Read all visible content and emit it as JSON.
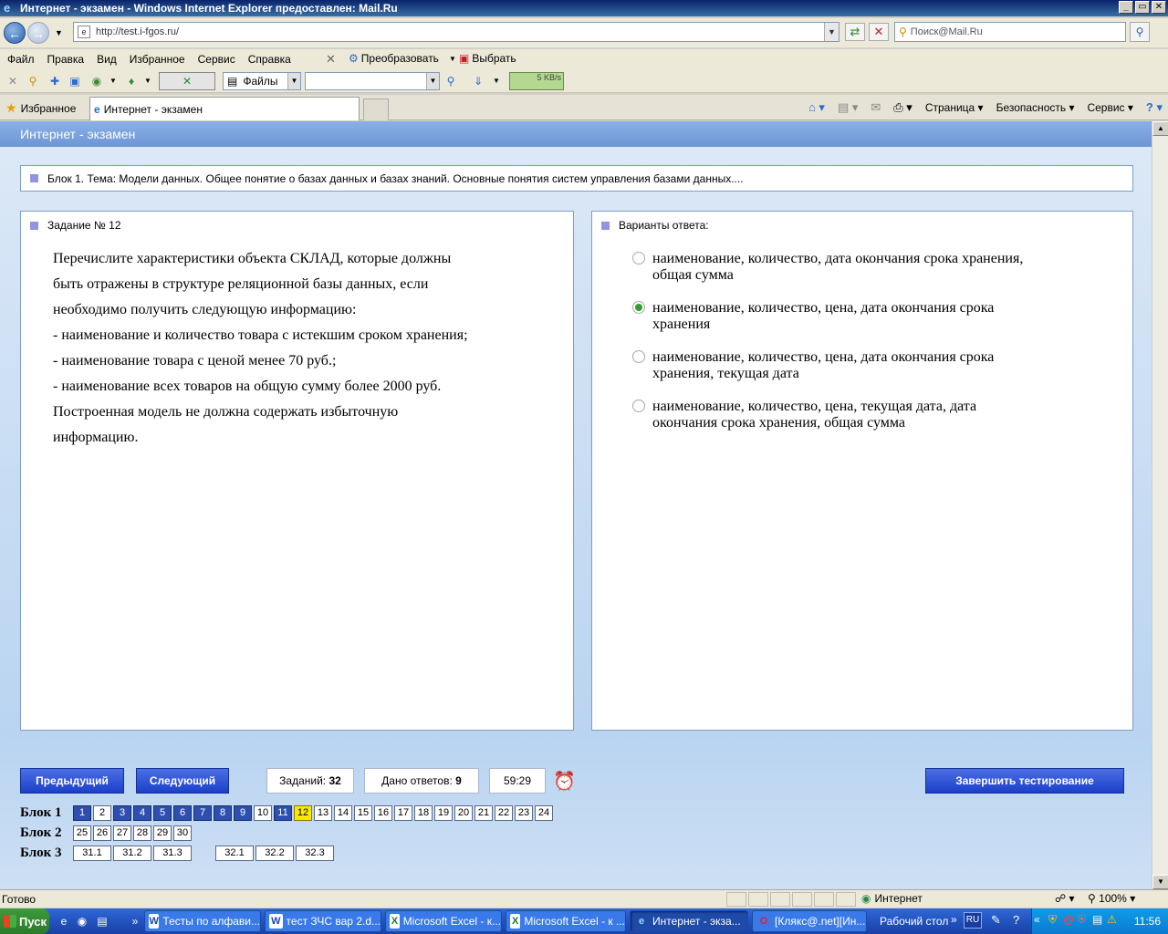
{
  "window": {
    "title": "Интернет - экзамен - Windows Internet Explorer предоставлен: Mail.Ru",
    "min": "_",
    "max": "▭",
    "close": "✕"
  },
  "address": {
    "url": "http://test.i-fgos.ru/",
    "search_placeholder": "Поиск@Mail.Ru"
  },
  "menu": {
    "items": [
      "Файл",
      "Правка",
      "Вид",
      "Избранное",
      "Сервис",
      "Справка"
    ],
    "convert": "Преобразовать",
    "select": "Выбрать"
  },
  "toolbar": {
    "files_label": "Файлы",
    "speed": "5 KB/s"
  },
  "favbar": {
    "favorites": "Избранное",
    "tab_title": "Интернет - экзамен",
    "page": "Страница",
    "security": "Безопасность",
    "service": "Сервис"
  },
  "app": {
    "header": "Интернет - экзамен",
    "block_title": "Блок 1. Тема: Модели данных. Общее понятие о базах данных и базах знаний. Основные понятия систем управления базами данных....",
    "task_label": "Задание № 12",
    "question_lines": [
      "Перечислите характеристики объекта СКЛАД, которые должны",
      "быть отражены в структуре реляционной базы данных, если",
      "необходимо получить следующую информацию:",
      "- наименование и количество товара с истекшим сроком хранения;",
      "- наименование товара с ценой менее 70 руб.;",
      "- наименование всех товаров на общую сумму более 2000 руб.",
      "Построенная модель не должна содержать избыточную",
      "информацию."
    ],
    "answers_label": "Варианты ответа:",
    "options": [
      {
        "line1": "наименование, количество, дата окончания срока хранения,",
        "line2": "общая сумма",
        "selected": false
      },
      {
        "line1": "наименование, количество, цена, дата окончания срока",
        "line2": "хранения",
        "selected": true
      },
      {
        "line1": "наименование, количество, цена, дата окончания срока",
        "line2": "хранения, текущая дата",
        "selected": false
      },
      {
        "line1": "наименование, количество, цена, текущая дата, дата",
        "line2": "окончания срока хранения, общая сумма",
        "selected": false
      }
    ],
    "prev": "Предыдущий",
    "next": "Следующий",
    "tasks_label": "Заданий:",
    "tasks_count": "32",
    "answers_given_label": "Дано ответов:",
    "answers_given_count": "9",
    "timer": "59:29",
    "finish": "Завершить тестирование",
    "blocks": [
      {
        "label": "Блок 1",
        "items": [
          {
            "n": "1",
            "s": "done"
          },
          {
            "n": "2",
            "s": ""
          },
          {
            "n": "3",
            "s": "done"
          },
          {
            "n": "4",
            "s": "done"
          },
          {
            "n": "5",
            "s": "done"
          },
          {
            "n": "6",
            "s": "done"
          },
          {
            "n": "7",
            "s": "done"
          },
          {
            "n": "8",
            "s": "done"
          },
          {
            "n": "9",
            "s": "done"
          },
          {
            "n": "10",
            "s": ""
          },
          {
            "n": "11",
            "s": "done"
          },
          {
            "n": "12",
            "s": "cur"
          },
          {
            "n": "13",
            "s": ""
          },
          {
            "n": "14",
            "s": ""
          },
          {
            "n": "15",
            "s": ""
          },
          {
            "n": "16",
            "s": ""
          },
          {
            "n": "17",
            "s": ""
          },
          {
            "n": "18",
            "s": ""
          },
          {
            "n": "19",
            "s": ""
          },
          {
            "n": "20",
            "s": ""
          },
          {
            "n": "21",
            "s": ""
          },
          {
            "n": "22",
            "s": ""
          },
          {
            "n": "23",
            "s": ""
          },
          {
            "n": "24",
            "s": ""
          }
        ]
      },
      {
        "label": "Блок 2",
        "items": [
          {
            "n": "25",
            "s": ""
          },
          {
            "n": "26",
            "s": ""
          },
          {
            "n": "27",
            "s": ""
          },
          {
            "n": "28",
            "s": ""
          },
          {
            "n": "29",
            "s": ""
          },
          {
            "n": "30",
            "s": ""
          }
        ]
      },
      {
        "label": "Блок 3",
        "items": [
          {
            "n": "31.1",
            "s": ""
          },
          {
            "n": "31.2",
            "s": ""
          },
          {
            "n": "31.3",
            "s": ""
          },
          {
            "n": "32.1",
            "s": ""
          },
          {
            "n": "32.2",
            "s": ""
          },
          {
            "n": "32.3",
            "s": ""
          }
        ]
      }
    ]
  },
  "status": {
    "text": "Готово",
    "zone": "Интернет",
    "zoom": "100%"
  },
  "taskbar": {
    "start": "Пуск",
    "tasks": [
      {
        "icon": "W",
        "label": "Тесты по алфави..."
      },
      {
        "icon": "W",
        "label": "тест ЗЧС вар 2.d..."
      },
      {
        "icon": "X",
        "label": "Microsoft Excel - к..."
      },
      {
        "icon": "X",
        "label": "Microsoft Excel - к ..."
      },
      {
        "icon": "e",
        "label": "Интернет - экза..."
      },
      {
        "icon": "O",
        "label": "[Клякс@.net][Ин..."
      }
    ],
    "desktop": "Рабочий стол",
    "lang": "RU",
    "clock": "11:56"
  }
}
